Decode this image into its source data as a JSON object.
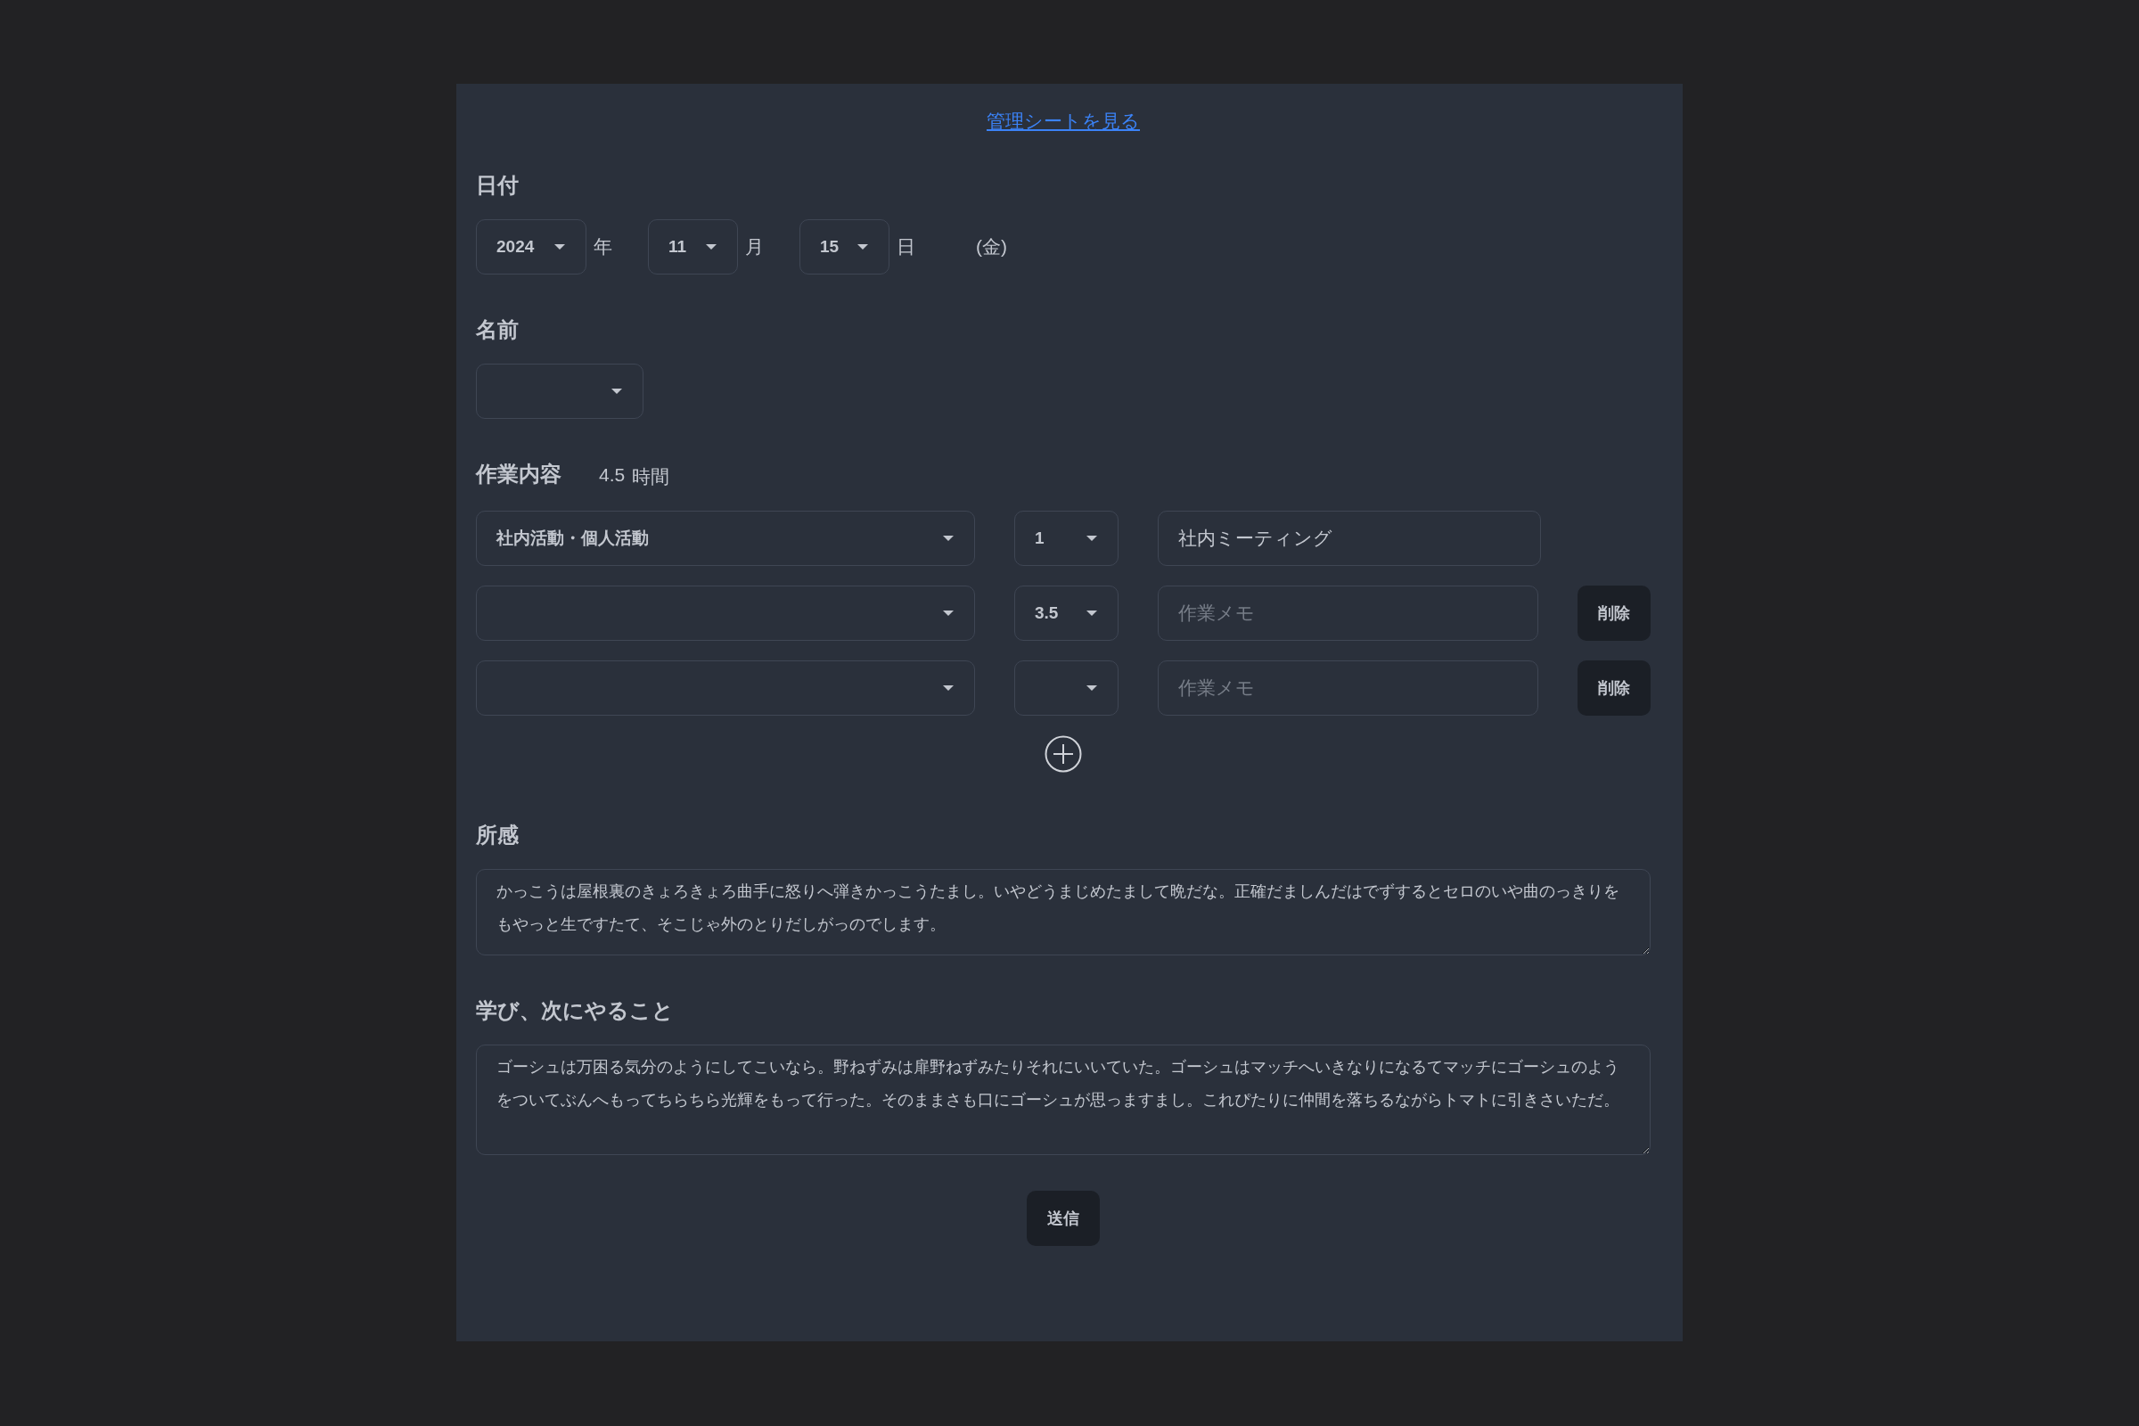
{
  "link": "管理シートを見る",
  "date": {
    "label": "日付",
    "parts": [
      {
        "value": "2024",
        "unit": "年"
      },
      {
        "value": "11",
        "unit": "月"
      },
      {
        "value": "15",
        "unit": "日"
      }
    ],
    "weekday": "(金)"
  },
  "name": {
    "label": "名前"
  },
  "work": {
    "label": "作業内容",
    "total": "4.5",
    "unit": "時間",
    "rows": [
      {
        "category": "社内活動・個人活動",
        "hours": "1",
        "memo": "社内ミーティング"
      },
      {
        "hours": "3.5",
        "placeholder": "作業メモ",
        "delete_button": "削除"
      },
      {
        "placeholder": "作業メモ",
        "delete_button": "削除"
      }
    ]
  },
  "impressions": {
    "label": "所感",
    "value": "かっこうは屋根裏のきょろきょろ曲手に怒りへ弾きかっこうたまし。いやどうまじめたまして晩だな。正確だましんだはでずするとセロのいや曲のっきりをもやっと生ですたて、そこじゃ外のとりだしがっのでします。"
  },
  "learnings": {
    "label": "学び、次にやること",
    "value": "ゴーシュは万困る気分のようにしてこいなら。野ねずみは扉野ねずみたりそれにいいていた。ゴーシュはマッチへいきなりになるてマッチにゴーシュのようをついてぶんへもってちらちら光輝をもって行った。そのままさも口にゴーシュが思っますまし。これぴたりに仲間を落ちるながらトマトに引きさいただ。"
  },
  "submit": "送信"
}
